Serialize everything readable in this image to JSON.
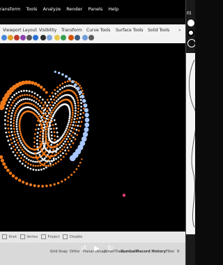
{
  "menu": [
    "ransform",
    "Tools",
    "Analyze",
    "Render",
    "Panels",
    "Help"
  ],
  "tabs": [
    "Viewport Layout",
    "Visibility",
    "Transform",
    "Curve Tools",
    "Surface Tools",
    "Solid Tools"
  ],
  "osnap": {
    "items": [
      "Knot",
      "Vertex",
      "Project",
      "Disable"
    ]
  },
  "status": {
    "grid_snap": "Grid Snap",
    "ortho": "Ortho",
    "planar": "Planar",
    "osnap": "Osnap",
    "smarttrack": "SmartTrack",
    "gumball": "Gumball",
    "record_history": "Record History",
    "filter": "Filter",
    "filter_value": "9"
  },
  "right_panel": {
    "label": "Fil"
  },
  "colors": {
    "accent_orange": "#f07a1a",
    "accent_white": "#f2f2f2",
    "accent_blue": "#a8c8ff"
  }
}
